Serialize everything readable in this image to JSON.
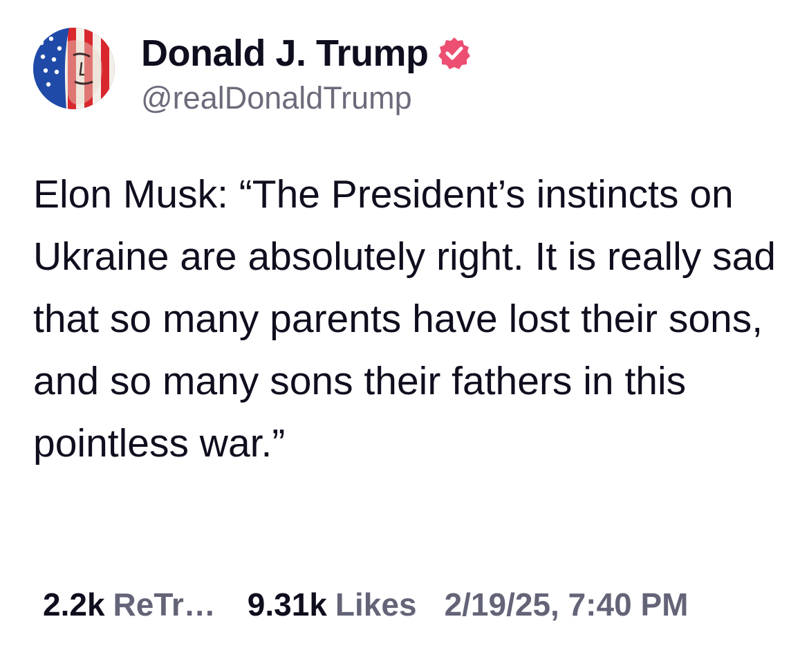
{
  "author": {
    "display_name": "Donald J. Trump",
    "handle": "@realDonaldTrump",
    "verified_icon": "verified-badge-icon",
    "avatar_icon": "flag-portrait-avatar"
  },
  "post": {
    "text": "Elon Musk: “The President’s instincts on Ukraine are absolutely right. It is really sad that so many parents have lost their sons, and so many sons their fathers in this pointless war.”"
  },
  "stats": {
    "retruths_count": "2.2k",
    "retruths_label": "ReTr…",
    "likes_count": "9.31k",
    "likes_label": "Likes",
    "timestamp": "2/19/25, 7:40 PM"
  },
  "colors": {
    "text": "#0f0e1e",
    "secondary_text": "#646478",
    "verified_badge": "#ec4f72",
    "background": "#ffffff"
  }
}
